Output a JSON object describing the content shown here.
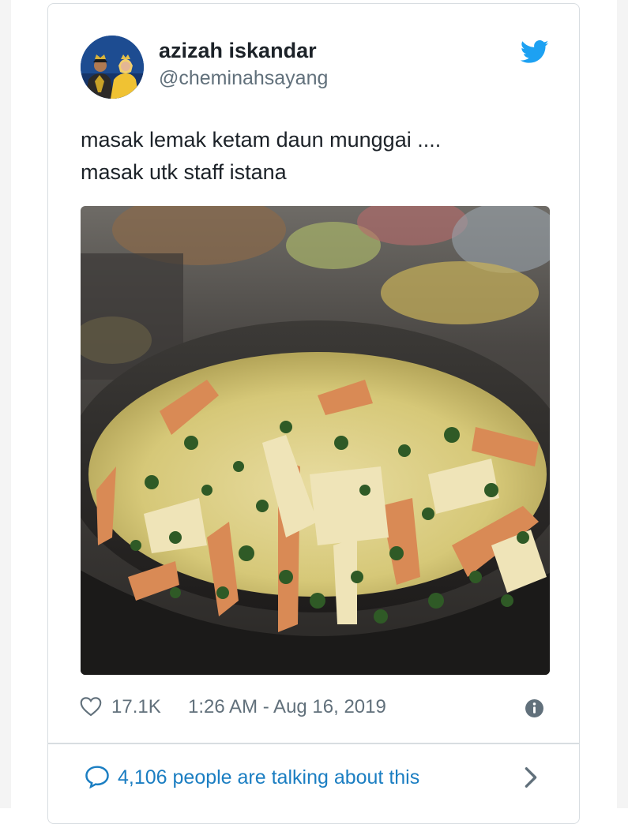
{
  "tweet": {
    "author": {
      "display_name": "azizah iskandar",
      "handle": "@cheminahsayang",
      "avatar": "profile-avatar"
    },
    "brand_icon": "twitter-bird-icon",
    "text_lines": [
      "masak lemak ketam daun munggai ....",
      "masak utk staff istana"
    ],
    "photo": "crab-curry-photo",
    "likes": "17.1K",
    "timestamp": "1:26 AM - Aug 16, 2019",
    "conversation": "4,106 people are talking about this"
  },
  "colors": {
    "text": "#1c2228",
    "muted": "#61707b",
    "accent": "#1b7ec2",
    "twitter_blue": "#1da1f2",
    "border": "#d8dde1"
  },
  "icons": {
    "like": "heart-icon",
    "info": "info-icon",
    "reply": "speech-bubble-icon",
    "more": "chevron-right-icon"
  }
}
